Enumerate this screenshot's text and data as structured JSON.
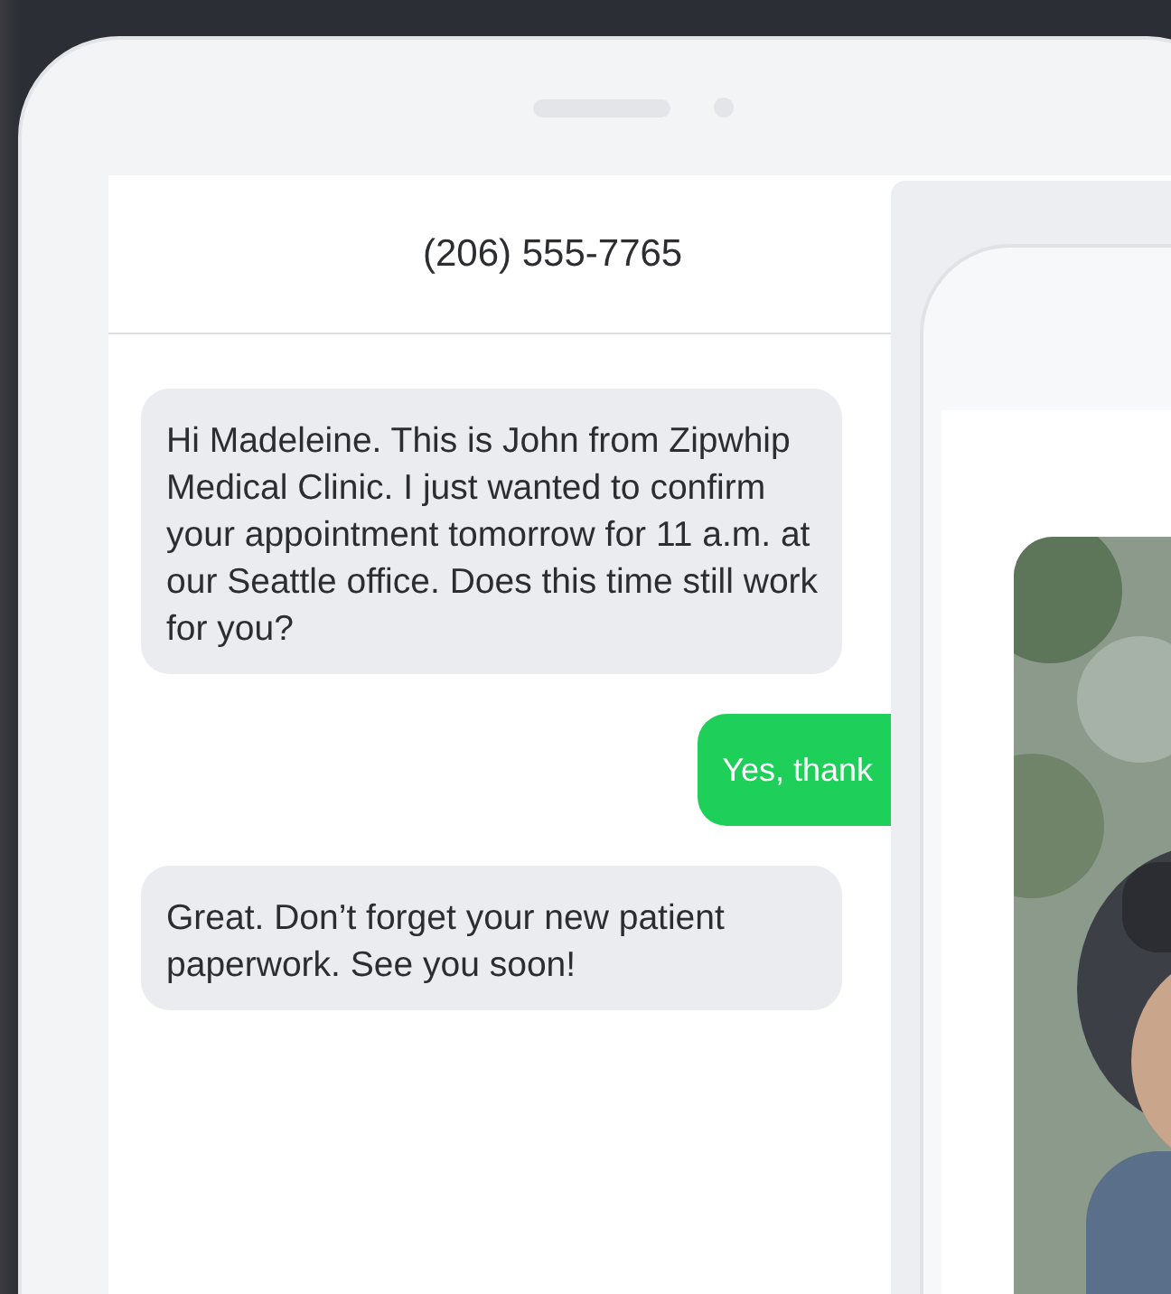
{
  "phone": {
    "contact": "(206) 555-7765",
    "messages": [
      {
        "kind": "received",
        "text": "Hi Madeleine. This is John from Zipwhip Medical Clinic. I just wanted to confirm your appointment tomorrow for 11 a.m. at our Seattle office. Does this time still work for you?"
      },
      {
        "kind": "sent",
        "text": "Yes, thank"
      },
      {
        "kind": "received",
        "text": "Great. Don’t forget your new patient paperwork. See you soon!"
      }
    ]
  }
}
